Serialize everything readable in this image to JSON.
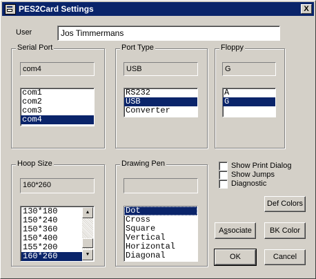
{
  "window": {
    "title": "PES2Card Settings",
    "close_glyph": "X"
  },
  "user": {
    "label": "User",
    "value": "Jos Timmermans"
  },
  "serial_port": {
    "title": "Serial Port",
    "current": "com4",
    "options": [
      "com1",
      "com2",
      "com3",
      "com4"
    ],
    "selected": "com4"
  },
  "port_type": {
    "title": "Port Type",
    "current": "USB",
    "options": [
      "RS232",
      "USB",
      "Converter"
    ],
    "selected": "USB"
  },
  "floppy": {
    "title": "Floppy",
    "current": "G",
    "options": [
      "A",
      "G"
    ],
    "selected": "G"
  },
  "hoop_size": {
    "title": "Hoop Size",
    "current": "160*260",
    "options": [
      "130*180",
      "150*240",
      "150*360",
      "150*400",
      "155*200",
      "160*260"
    ],
    "selected": "160*260"
  },
  "drawing_pen": {
    "title": "Drawing Pen",
    "current": "",
    "options": [
      "Dot",
      "Cross",
      "Square",
      "Vertical",
      "Horizontal",
      "Diagonal"
    ],
    "selected": "Dot"
  },
  "checkboxes": {
    "show_print_dialog": {
      "label": "Show Print Dialog",
      "checked": false
    },
    "show_jumps": {
      "label": "Show Jumps",
      "checked": false
    },
    "diagnostic": {
      "label": "Diagnostic",
      "checked": false
    }
  },
  "buttons": {
    "def_colors": "Def Colors",
    "associate_prefix": "A",
    "associate_accel": "s",
    "associate_suffix": "sociate",
    "bk_color": "BK Color",
    "ok": "OK",
    "cancel": "Cancel"
  }
}
